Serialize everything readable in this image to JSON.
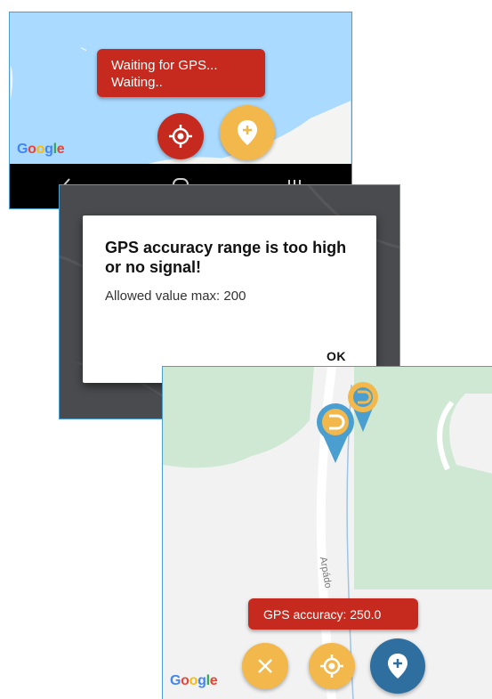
{
  "panel1": {
    "toast": {
      "line1": "Waiting for GPS...",
      "line2": "Waiting.."
    },
    "google_logo": [
      "G",
      "o",
      "o",
      "g",
      "l",
      "e"
    ],
    "fab_locate_color": "#c62a1e",
    "fab_add_color": "#f2b84b",
    "icons": {
      "locate": "crosshair-icon",
      "add": "add-location-icon",
      "back": "back-icon",
      "home": "home-icon",
      "recents": "recents-icon"
    }
  },
  "panel2": {
    "dialog": {
      "title": "GPS accuracy range is too high or no signal!",
      "message": "Allowed value max: 200",
      "ok": "OK"
    }
  },
  "panel3": {
    "toast": "GPS accuracy: 250.0",
    "street_label": "Arpádo",
    "google_logo": [
      "G",
      "o",
      "o",
      "g",
      "l",
      "e"
    ],
    "fab_cancel_color": "#f2b84b",
    "fab_locate_color": "#f2b84b",
    "fab_add_color": "#2f6f9f",
    "pins": [
      {
        "name": "pin-orange",
        "color": "#f2b84b"
      },
      {
        "name": "pin-blue",
        "color": "#4a9fd0"
      }
    ],
    "icons": {
      "cancel": "close-icon",
      "locate": "crosshair-icon",
      "add": "add-location-icon"
    }
  }
}
